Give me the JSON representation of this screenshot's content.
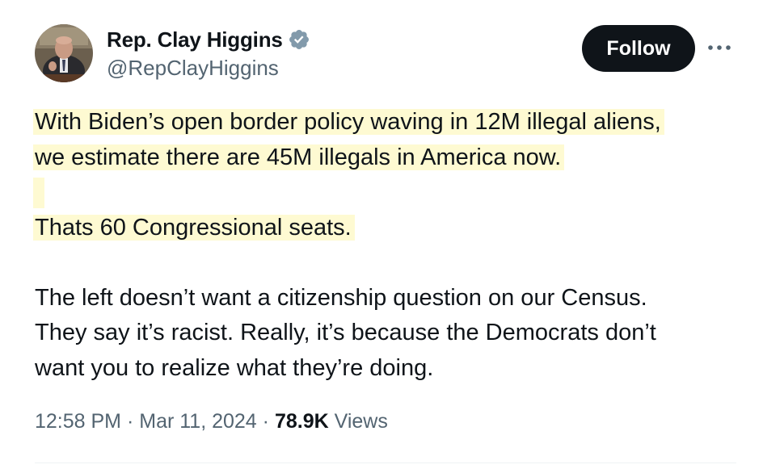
{
  "author": {
    "display_name": "Rep. Clay Higgins",
    "handle": "@RepClayHiggins",
    "verified": true
  },
  "actions": {
    "follow_label": "Follow",
    "more_icon": "more-horizontal-icon"
  },
  "tweet": {
    "lines": [
      "With Biden’s open border policy waving in 12M illegal aliens,",
      "we estimate there are 45M illegals in America now.",
      "",
      "Thats 60 Congressional seats.",
      "",
      "The left doesn’t want a citizenship question on our Census.",
      "They say it’s racist. Really, it’s because the Democrats don’t",
      "want you to realize what they’re doing."
    ],
    "highlight_color": "#fefad2"
  },
  "meta": {
    "time": "12:58 PM",
    "separator": "·",
    "date": "Mar 11, 2024",
    "views_count": "78.9K",
    "views_label": "Views"
  },
  "colors": {
    "text": "#0f1419",
    "secondary": "#536471",
    "verified_badge": "#829aab",
    "follow_bg": "#0f1419"
  }
}
